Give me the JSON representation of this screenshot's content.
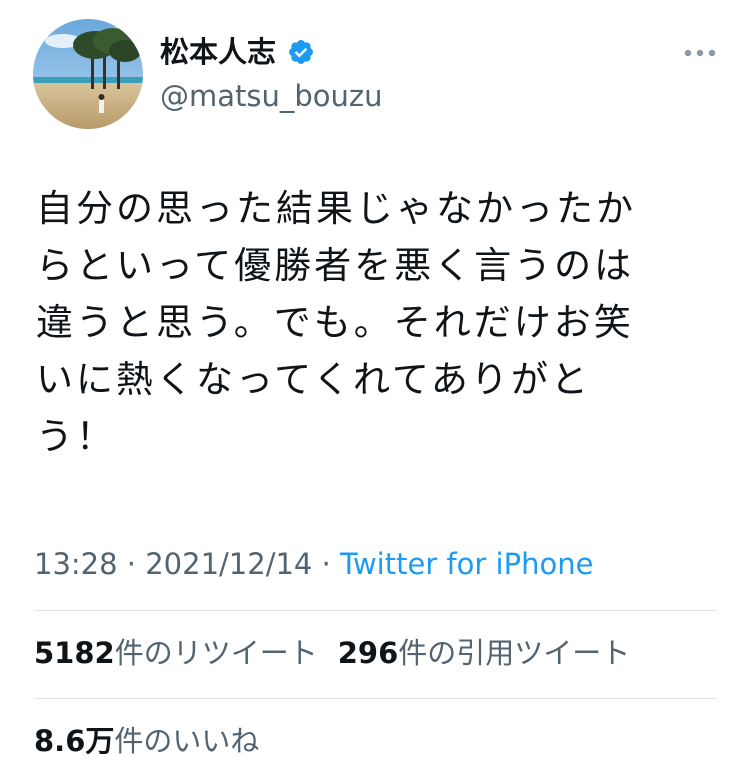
{
  "user": {
    "display_name": "松本人志",
    "handle": "@matsu_bouzu",
    "avatar_icon": "profile-photo-beach-trees",
    "verified_icon": "verified-badge-icon",
    "verified_color": "#1d9bf0"
  },
  "menu": {
    "icon": "more-horizontal-icon"
  },
  "tweet": {
    "text": "自分の思った結果じゃなかったか\nらといって優勝者を悪く言うのは\n違うと思う。でも。それだけお笑\nいに熱くなってくれてありがと\nう！",
    "time": "13:28",
    "separator1": " · ",
    "date": "2021/12/14",
    "separator2": " · ",
    "source": "Twitter for iPhone"
  },
  "stats": {
    "retweets_count": "5182",
    "retweets_label": "件のリツイート",
    "quotes_count": "296",
    "quotes_label": "件の引用ツイート",
    "likes_count": "8.6万",
    "likes_label": "件のいいね"
  },
  "colors": {
    "link": "#1d9bf0",
    "secondary_text": "#536471",
    "primary_text": "#0f1419",
    "divider": "#dfe3e7"
  }
}
